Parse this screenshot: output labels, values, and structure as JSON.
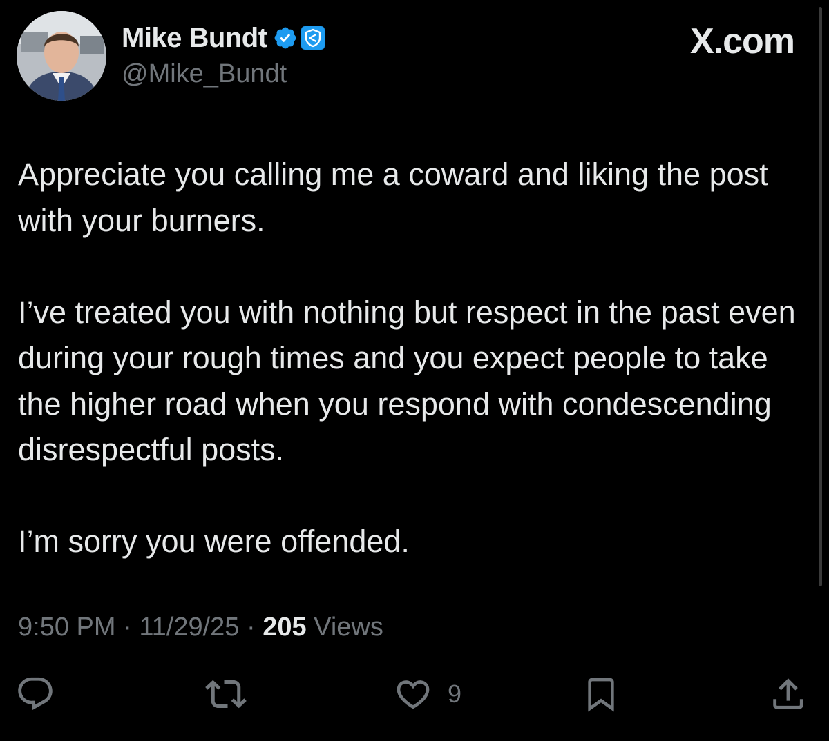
{
  "author": {
    "display_name": "Mike Bundt",
    "handle": "@Mike_Bundt",
    "badges": [
      "verified-checkmark-icon",
      "shield-affiliate-icon"
    ]
  },
  "brand": {
    "logo_text": "X.com"
  },
  "tweet": {
    "paragraphs": [
      "Appreciate you calling me a coward and liking the post with your burners.",
      "I’ve treated you with nothing but respect in the past even during your rough times and you expect people to take the higher road when you respond with condescending disrespectful posts.",
      "I’m sorry you were offended."
    ]
  },
  "meta": {
    "time": "9:50 PM",
    "separator": "·",
    "date": "11/29/25",
    "views_count": "205",
    "views_label": "Views"
  },
  "actions": {
    "reply_icon": "reply-icon",
    "repost_icon": "repost-icon",
    "like_icon": "heart-icon",
    "like_count": "9",
    "bookmark_icon": "bookmark-icon",
    "share_icon": "share-icon"
  },
  "colors": {
    "background": "#000000",
    "text_primary": "#e7e9ea",
    "text_secondary": "#71767b",
    "verified_blue": "#1d9bf0"
  }
}
